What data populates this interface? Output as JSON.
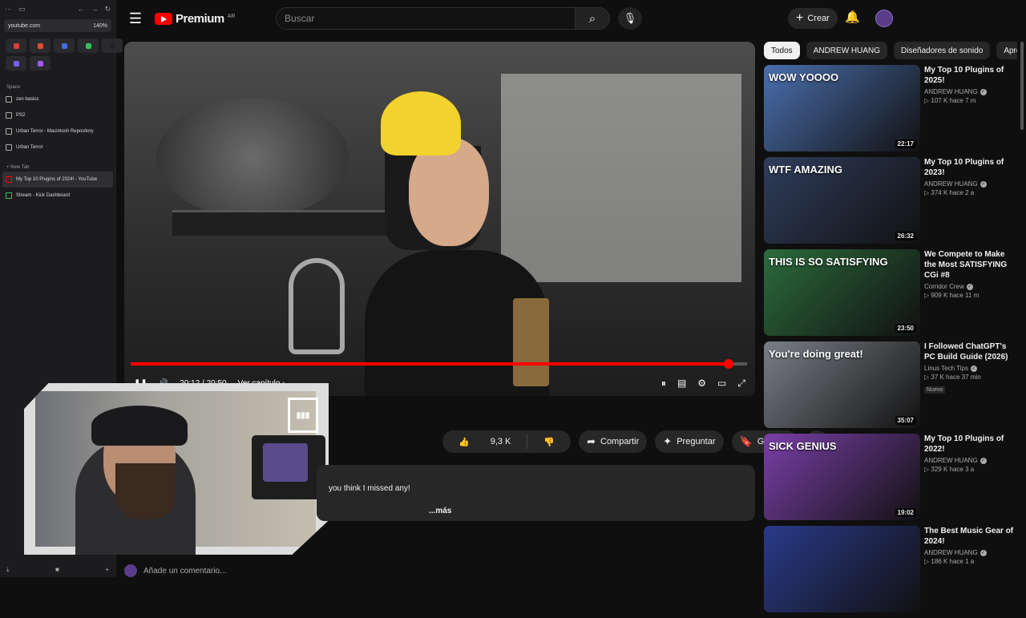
{
  "browser": {
    "url": "youtube.com",
    "zoom": "140%",
    "space_label": "Space",
    "tabs": [
      {
        "label": "zen basics"
      },
      {
        "label": "PS2"
      },
      {
        "label": "Urban Terror - Macintosh Repository"
      },
      {
        "label": "Urban Terror"
      }
    ],
    "new_tab": "New Tab",
    "open_tabs": [
      {
        "label": "My Top 10 Plugins of 2024! - YouTube"
      },
      {
        "label": "Stream - Kick Dashboard"
      }
    ],
    "pin_colors": [
      "#e03b3b",
      "#e34b2f",
      "#3f6ee0",
      "#35c060",
      "#222222",
      "#7c5cf0",
      "#a259ff"
    ]
  },
  "header": {
    "logo_text": "Premium",
    "logo_region": "AR",
    "search_placeholder": "Buscar",
    "create_label": "Crear"
  },
  "player": {
    "current_time": "20:12",
    "duration": "20:50",
    "chapters_label": "Ver capítulo",
    "progress": 0.97
  },
  "actions": {
    "likes": "9,3 K",
    "share": "Compartir",
    "ask": "Preguntar",
    "save": "Guardar"
  },
  "description": {
    "text": "you think I missed any!",
    "more": "...más"
  },
  "comment_placeholder": "Añade un comentario...",
  "chips": [
    "Todos",
    "ANDREW HUANG",
    "Diseñadores de sonido",
    "Aprendi"
  ],
  "recommendations": [
    {
      "title": "My Top 10 Plugins of 2025!",
      "channel": "ANDREW HUANG",
      "meta": "▷ 107 K  hace 7 m",
      "duration": "22:17",
      "thumb_text": "WOW  YOOOO",
      "color": "#4a6fae"
    },
    {
      "title": "My Top 10 Plugins of 2023!",
      "channel": "ANDREW HUANG",
      "meta": "▷ 374 K  hace 2 a",
      "duration": "26:32",
      "thumb_text": "WTF  AMAZING",
      "color": "#2f3d5c"
    },
    {
      "title": "We Compete to Make the Most SATISFYING CGi #8",
      "channel": "Corridor Crew",
      "meta": "▷ 909 K  hace 11 m",
      "duration": "23:50",
      "thumb_text": "THIS IS SO SATISFYING",
      "color": "#2b6b3b"
    },
    {
      "title": "I Followed ChatGPT's PC Build Guide (2026)",
      "channel": "Linus Tech Tips",
      "meta": "▷ 37 K  hace 37 min",
      "duration": "35:07",
      "thumb_text": "You're doing great!",
      "color": "#7a7f86",
      "badge": "Nuevo"
    },
    {
      "title": "My Top 10 Plugins of 2022!",
      "channel": "ANDREW HUANG",
      "meta": "▷ 329 K  hace 3 a",
      "duration": "19:02",
      "thumb_text": "SICK  GENIUS",
      "color": "#7a3fa8"
    },
    {
      "title": "The Best Music Gear of 2024!",
      "channel": "ANDREW HUANG",
      "meta": "▷ 186 K  hace 1 a",
      "duration": "",
      "thumb_text": "",
      "color": "#2a3a8a"
    }
  ],
  "webcam": {
    "logo_text": "▮▮▮"
  }
}
